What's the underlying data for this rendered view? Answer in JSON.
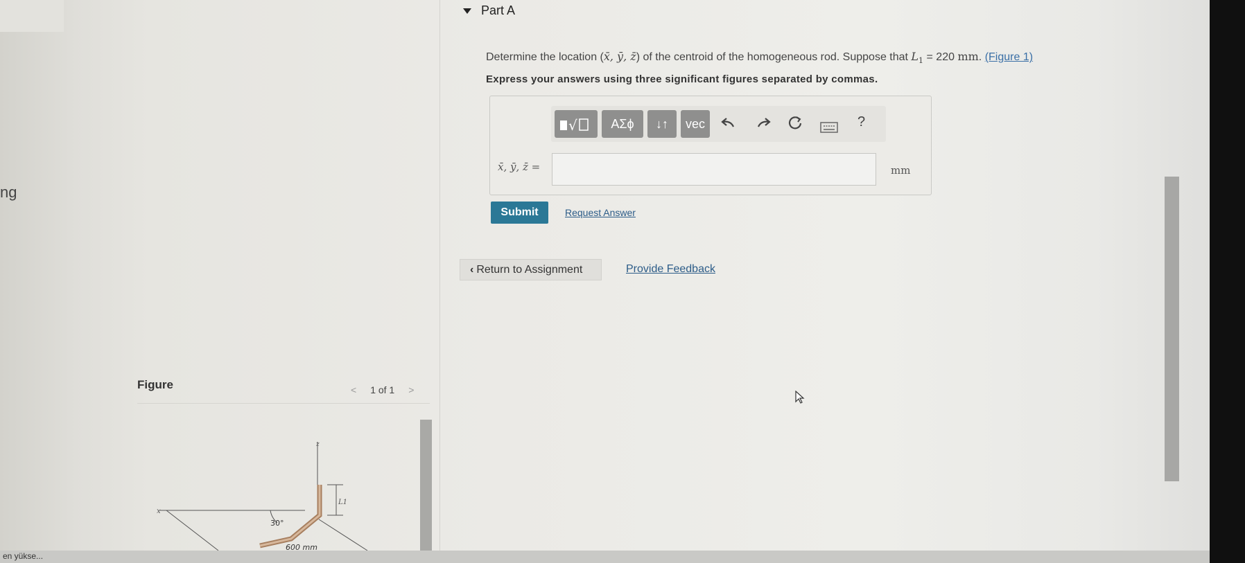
{
  "sidebar": {
    "partial_text": "ng"
  },
  "part": {
    "title": "Part A"
  },
  "question": {
    "text_before": "Determine the location (",
    "vars": "x̄, ȳ, z̄",
    "text_middle": ") of the centroid of the homogeneous rod. Suppose that",
    "param": "L",
    "param_sub": "1",
    "param_value": "= 220",
    "param_unit": "mm",
    "text_after": ".",
    "figure_link": "(Figure 1)"
  },
  "instructions": "Express your answers using three significant figures separated by commas.",
  "toolbar": {
    "templates_icon": "templates-icon",
    "greek_label": "ΑΣϕ",
    "arrows_label": "↓↑",
    "vec_label": "vec",
    "undo_icon": "undo-icon",
    "redo_icon": "redo-icon",
    "reset_icon": "reset-icon",
    "keyboard_icon": "keyboard-icon",
    "help_label": "?"
  },
  "answer": {
    "label": "x̄, ȳ, z̄ =",
    "value": "",
    "unit": "mm"
  },
  "actions": {
    "submit": "Submit",
    "request_answer": "Request Answer"
  },
  "nav": {
    "return": "Return to Assignment",
    "feedback": "Provide Feedback"
  },
  "figure": {
    "title": "Figure",
    "pager": "1 of 1",
    "labels": {
      "z": "z",
      "x": "x",
      "l1": "L1",
      "angle": "30°",
      "dim": "600 mm"
    }
  },
  "taskbar": {
    "text": "en yükse..."
  },
  "colors": {
    "submit_bg": "#2b7896",
    "link": "#2c5c88",
    "toolbar_btn": "#8f8f8e"
  }
}
